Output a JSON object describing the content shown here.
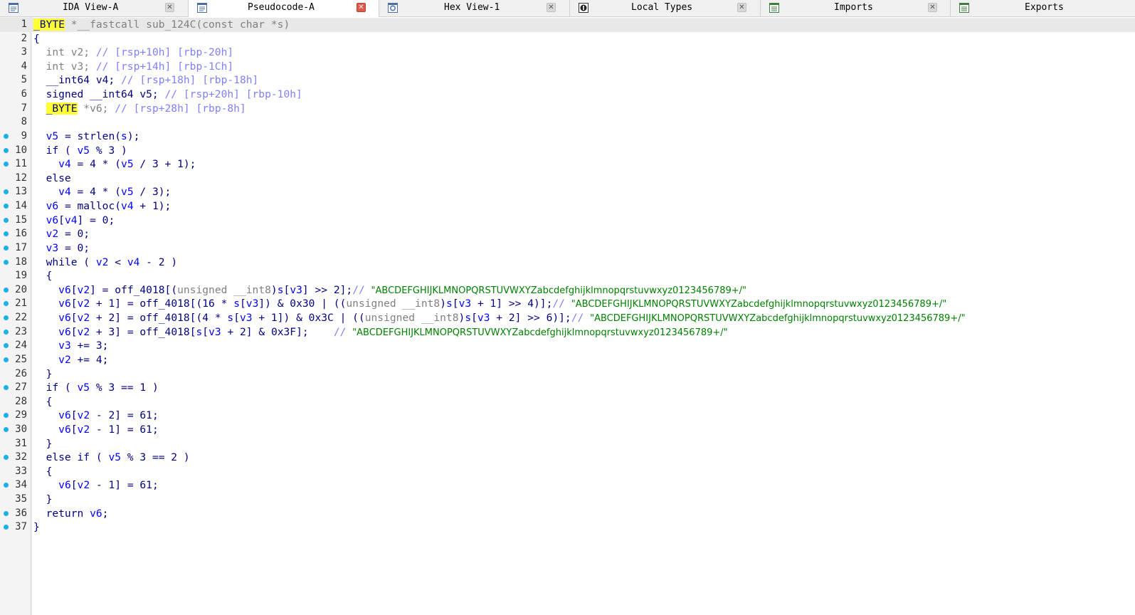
{
  "tabs": [
    {
      "label": "IDA View-A",
      "icon": "listing-icon",
      "active": false,
      "close": "gray"
    },
    {
      "label": "Pseudocode-A",
      "icon": "pseudocode-icon",
      "active": true,
      "close": "red"
    },
    {
      "label": "Hex View-1",
      "icon": "hex-view-icon",
      "active": false,
      "close": "gray"
    },
    {
      "label": "Local Types",
      "icon": "local-types-icon",
      "active": false,
      "close": "gray"
    },
    {
      "label": "Imports",
      "icon": "imports-icon",
      "active": false,
      "close": "gray"
    },
    {
      "label": "Exports",
      "icon": "exports-icon",
      "active": false,
      "close": "none"
    }
  ],
  "colors": {
    "keyword": "#000080",
    "variable": "#0000ff",
    "comment": "#8080ff",
    "string": "#008000",
    "highlight": "#ffff33",
    "breakpoint_dot": "#1ab0e8"
  },
  "lines": [
    {
      "n": "1",
      "dot": false,
      "tokens": [
        [
          "_BYTE",
          "hl"
        ],
        [
          " *__fastcall sub_124C(const char *s)",
          "gray"
        ]
      ]
    },
    {
      "n": "2",
      "dot": false,
      "tokens": [
        [
          "{",
          "code"
        ]
      ]
    },
    {
      "n": "3",
      "dot": false,
      "tokens": [
        [
          "  int v2; ",
          "gray"
        ],
        [
          "// [rsp+10h] [rbp-20h]",
          "cmt"
        ]
      ]
    },
    {
      "n": "4",
      "dot": false,
      "tokens": [
        [
          "  int v3; ",
          "gray"
        ],
        [
          "// [rsp+14h] [rbp-1Ch]",
          "cmt"
        ]
      ]
    },
    {
      "n": "5",
      "dot": false,
      "tokens": [
        [
          "  __int64 v4; ",
          "code"
        ],
        [
          "// [rsp+18h] [rbp-18h]",
          "cmt"
        ]
      ]
    },
    {
      "n": "6",
      "dot": false,
      "tokens": [
        [
          "  signed __int64 v5; ",
          "code"
        ],
        [
          "// [rsp+20h] [rbp-10h]",
          "cmt"
        ]
      ]
    },
    {
      "n": "7",
      "dot": false,
      "tokens": [
        [
          "  ",
          "code"
        ],
        [
          "_BYTE",
          "hl"
        ],
        [
          " *v6; ",
          "gray"
        ],
        [
          "// [rsp+28h] [rbp-8h]",
          "cmt"
        ]
      ]
    },
    {
      "n": "8",
      "dot": false,
      "tokens": []
    },
    {
      "n": "9",
      "dot": true,
      "tokens": [
        [
          "  ",
          "code"
        ],
        [
          "v5",
          "var"
        ],
        [
          " = strlen(",
          "code"
        ],
        [
          "s",
          "var"
        ],
        [
          ");",
          "code"
        ]
      ]
    },
    {
      "n": "10",
      "dot": true,
      "tokens": [
        [
          "  if ( ",
          "code"
        ],
        [
          "v5",
          "var"
        ],
        [
          " % 3 )",
          "code"
        ]
      ]
    },
    {
      "n": "11",
      "dot": true,
      "tokens": [
        [
          "    ",
          "code"
        ],
        [
          "v4",
          "var"
        ],
        [
          " = 4 * (",
          "code"
        ],
        [
          "v5",
          "var"
        ],
        [
          " / 3 + 1);",
          "code"
        ]
      ]
    },
    {
      "n": "12",
      "dot": false,
      "tokens": [
        [
          "  else",
          "code"
        ]
      ]
    },
    {
      "n": "13",
      "dot": true,
      "tokens": [
        [
          "    ",
          "code"
        ],
        [
          "v4",
          "var"
        ],
        [
          " = 4 * (",
          "code"
        ],
        [
          "v5",
          "var"
        ],
        [
          " / 3);",
          "code"
        ]
      ]
    },
    {
      "n": "14",
      "dot": true,
      "tokens": [
        [
          "  ",
          "code"
        ],
        [
          "v6",
          "var"
        ],
        [
          " = malloc(",
          "code"
        ],
        [
          "v4",
          "var"
        ],
        [
          " + 1);",
          "code"
        ]
      ]
    },
    {
      "n": "15",
      "dot": true,
      "tokens": [
        [
          "  ",
          "code"
        ],
        [
          "v6",
          "var"
        ],
        [
          "[",
          "code"
        ],
        [
          "v4",
          "var"
        ],
        [
          "] = 0;",
          "code"
        ]
      ]
    },
    {
      "n": "16",
      "dot": true,
      "tokens": [
        [
          "  ",
          "code"
        ],
        [
          "v2",
          "var"
        ],
        [
          " = 0;",
          "code"
        ]
      ]
    },
    {
      "n": "17",
      "dot": true,
      "tokens": [
        [
          "  ",
          "code"
        ],
        [
          "v3",
          "var"
        ],
        [
          " = 0;",
          "code"
        ]
      ]
    },
    {
      "n": "18",
      "dot": true,
      "tokens": [
        [
          "  while ( ",
          "code"
        ],
        [
          "v2",
          "var"
        ],
        [
          " < ",
          "code"
        ],
        [
          "v4",
          "var"
        ],
        [
          " - 2 )",
          "code"
        ]
      ]
    },
    {
      "n": "19",
      "dot": false,
      "tokens": [
        [
          "  {",
          "code"
        ]
      ]
    },
    {
      "n": "20",
      "dot": true,
      "tokens": [
        [
          "    ",
          "code"
        ],
        [
          "v6",
          "var"
        ],
        [
          "[",
          "code"
        ],
        [
          "v2",
          "var"
        ],
        [
          "] = off_4018[(",
          "code"
        ],
        [
          "unsigned __int8",
          "gray"
        ],
        [
          ")",
          "code"
        ],
        [
          "s",
          "var"
        ],
        [
          "[",
          "code"
        ],
        [
          "v3",
          "var"
        ],
        [
          "] >> 2];",
          "code"
        ],
        [
          "// ",
          "cmt"
        ],
        [
          "\"ABCDEFGHIJKLMNOPQRSTUVWXYZabcdefghijklmnopqrstuvwxyz0123456789+/\"",
          "str"
        ]
      ]
    },
    {
      "n": "21",
      "dot": true,
      "tokens": [
        [
          "    ",
          "code"
        ],
        [
          "v6",
          "var"
        ],
        [
          "[",
          "code"
        ],
        [
          "v2",
          "var"
        ],
        [
          " + 1] = off_4018[(16 * ",
          "code"
        ],
        [
          "s",
          "var"
        ],
        [
          "[",
          "code"
        ],
        [
          "v3",
          "var"
        ],
        [
          "]) & 0x30 | ((",
          "code"
        ],
        [
          "unsigned __int8",
          "gray"
        ],
        [
          ")",
          "code"
        ],
        [
          "s",
          "var"
        ],
        [
          "[",
          "code"
        ],
        [
          "v3",
          "var"
        ],
        [
          " + 1] >> 4)];",
          "code"
        ],
        [
          "// ",
          "cmt"
        ],
        [
          "\"ABCDEFGHIJKLMNOPQRSTUVWXYZabcdefghijklmnopqrstuvwxyz0123456789+/\"",
          "str"
        ]
      ]
    },
    {
      "n": "22",
      "dot": true,
      "tokens": [
        [
          "    ",
          "code"
        ],
        [
          "v6",
          "var"
        ],
        [
          "[",
          "code"
        ],
        [
          "v2",
          "var"
        ],
        [
          " + 2] = off_4018[(4 * ",
          "code"
        ],
        [
          "s",
          "var"
        ],
        [
          "[",
          "code"
        ],
        [
          "v3",
          "var"
        ],
        [
          " + 1]) & 0x3C | ((",
          "code"
        ],
        [
          "unsigned __int8",
          "gray"
        ],
        [
          ")",
          "code"
        ],
        [
          "s",
          "var"
        ],
        [
          "[",
          "code"
        ],
        [
          "v3",
          "var"
        ],
        [
          " + 2] >> 6)];",
          "code"
        ],
        [
          "// ",
          "cmt"
        ],
        [
          "\"ABCDEFGHIJKLMNOPQRSTUVWXYZabcdefghijklmnopqrstuvwxyz0123456789+/\"",
          "str"
        ]
      ]
    },
    {
      "n": "23",
      "dot": true,
      "tokens": [
        [
          "    ",
          "code"
        ],
        [
          "v6",
          "var"
        ],
        [
          "[",
          "code"
        ],
        [
          "v2",
          "var"
        ],
        [
          " + 3] = off_4018[",
          "code"
        ],
        [
          "s",
          "var"
        ],
        [
          "[",
          "code"
        ],
        [
          "v3",
          "var"
        ],
        [
          " + 2] & 0x3F];    ",
          "code"
        ],
        [
          "// ",
          "cmt"
        ],
        [
          "\"ABCDEFGHIJKLMNOPQRSTUVWXYZabcdefghijklmnopqrstuvwxyz0123456789+/\"",
          "str"
        ]
      ]
    },
    {
      "n": "24",
      "dot": true,
      "tokens": [
        [
          "    ",
          "code"
        ],
        [
          "v3",
          "var"
        ],
        [
          " += 3;",
          "code"
        ]
      ]
    },
    {
      "n": "25",
      "dot": true,
      "tokens": [
        [
          "    ",
          "code"
        ],
        [
          "v2",
          "var"
        ],
        [
          " += 4;",
          "code"
        ]
      ]
    },
    {
      "n": "26",
      "dot": false,
      "tokens": [
        [
          "  }",
          "code"
        ]
      ]
    },
    {
      "n": "27",
      "dot": true,
      "tokens": [
        [
          "  if ( ",
          "code"
        ],
        [
          "v5",
          "var"
        ],
        [
          " % 3 == 1 )",
          "code"
        ]
      ]
    },
    {
      "n": "28",
      "dot": false,
      "tokens": [
        [
          "  {",
          "code"
        ]
      ]
    },
    {
      "n": "29",
      "dot": true,
      "tokens": [
        [
          "    ",
          "code"
        ],
        [
          "v6",
          "var"
        ],
        [
          "[",
          "code"
        ],
        [
          "v2",
          "var"
        ],
        [
          " - 2] = 61;",
          "code"
        ]
      ]
    },
    {
      "n": "30",
      "dot": true,
      "tokens": [
        [
          "    ",
          "code"
        ],
        [
          "v6",
          "var"
        ],
        [
          "[",
          "code"
        ],
        [
          "v2",
          "var"
        ],
        [
          " - 1] = 61;",
          "code"
        ]
      ]
    },
    {
      "n": "31",
      "dot": false,
      "tokens": [
        [
          "  }",
          "code"
        ]
      ]
    },
    {
      "n": "32",
      "dot": true,
      "tokens": [
        [
          "  else if ( ",
          "code"
        ],
        [
          "v5",
          "var"
        ],
        [
          " % 3 == 2 )",
          "code"
        ]
      ]
    },
    {
      "n": "33",
      "dot": false,
      "tokens": [
        [
          "  {",
          "code"
        ]
      ]
    },
    {
      "n": "34",
      "dot": true,
      "tokens": [
        [
          "    ",
          "code"
        ],
        [
          "v6",
          "var"
        ],
        [
          "[",
          "code"
        ],
        [
          "v2",
          "var"
        ],
        [
          " - 1] = 61;",
          "code"
        ]
      ]
    },
    {
      "n": "35",
      "dot": false,
      "tokens": [
        [
          "  }",
          "code"
        ]
      ]
    },
    {
      "n": "36",
      "dot": true,
      "tokens": [
        [
          "  return ",
          "code"
        ],
        [
          "v6",
          "var"
        ],
        [
          ";",
          "code"
        ]
      ]
    },
    {
      "n": "37",
      "dot": true,
      "tokens": [
        [
          "}",
          "code"
        ]
      ]
    }
  ]
}
